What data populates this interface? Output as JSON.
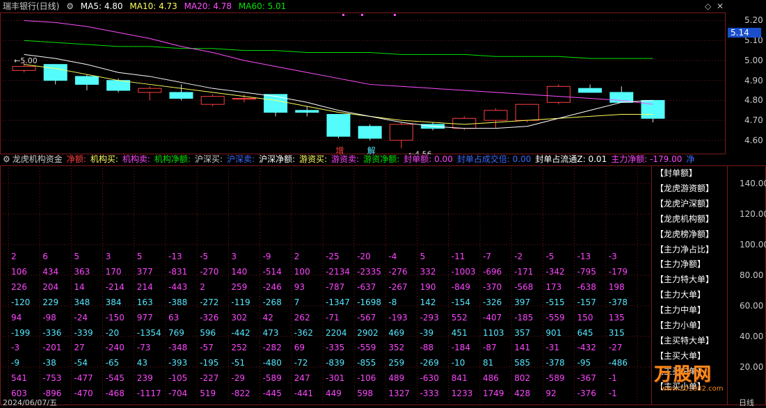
{
  "colors": {
    "up": "#ff4040",
    "down": "#54fcfc",
    "ma5": "#ffffff",
    "ma10": "#ffff5e",
    "ma20": "#ff4fff",
    "ma60": "#00e600",
    "grid": "#7a1a1a",
    "magenta": "#ff45ff",
    "cyan": "#54e8ff",
    "white": "#ffffff"
  },
  "header": {
    "title": "瑞丰银行(日线)",
    "ma5": "MA5: 4.80",
    "ma10": "MA10: 4.73",
    "ma20": "MA20: 4.78",
    "ma60": "MA60: 5.01"
  },
  "price_axis": {
    "labels": [
      "5.20",
      "5.10",
      "5.00",
      "4.90",
      "4.80",
      "4.70",
      "4.60"
    ],
    "current": "5.14"
  },
  "annotations": {
    "high": "5.00",
    "low": "4.56",
    "tag1": "增",
    "tag2": "解"
  },
  "chart_data": {
    "type": "candlestick",
    "ylim": [
      4.53,
      5.24
    ],
    "candles": [
      {
        "o": 4.95,
        "h": 5.0,
        "l": 4.94,
        "c": 4.97
      },
      {
        "o": 4.98,
        "h": 4.98,
        "l": 4.88,
        "c": 4.9
      },
      {
        "o": 4.92,
        "h": 4.93,
        "l": 4.85,
        "c": 4.88
      },
      {
        "o": 4.9,
        "h": 4.91,
        "l": 4.84,
        "c": 4.85
      },
      {
        "o": 4.84,
        "h": 4.87,
        "l": 4.8,
        "c": 4.86
      },
      {
        "o": 4.84,
        "h": 4.88,
        "l": 4.8,
        "c": 4.81
      },
      {
        "o": 4.78,
        "h": 4.83,
        "l": 4.77,
        "c": 4.82
      },
      {
        "o": 4.81,
        "h": 4.83,
        "l": 4.79,
        "c": 4.81
      },
      {
        "o": 4.83,
        "h": 4.83,
        "l": 4.72,
        "c": 4.74
      },
      {
        "o": 4.75,
        "h": 4.77,
        "l": 4.72,
        "c": 4.74
      },
      {
        "o": 4.73,
        "h": 4.73,
        "l": 4.61,
        "c": 4.62
      },
      {
        "o": 4.67,
        "h": 4.68,
        "l": 4.6,
        "c": 4.61
      },
      {
        "o": 4.6,
        "h": 4.69,
        "l": 4.56,
        "c": 4.68
      },
      {
        "o": 4.68,
        "h": 4.69,
        "l": 4.65,
        "c": 4.66
      },
      {
        "o": 4.66,
        "h": 4.72,
        "l": 4.65,
        "c": 4.71
      },
      {
        "o": 4.7,
        "h": 4.76,
        "l": 4.66,
        "c": 4.75
      },
      {
        "o": 4.7,
        "h": 4.78,
        "l": 4.69,
        "c": 4.78
      },
      {
        "o": 4.79,
        "h": 4.88,
        "l": 4.78,
        "c": 4.87
      },
      {
        "o": 4.86,
        "h": 4.88,
        "l": 4.84,
        "c": 4.84
      },
      {
        "o": 4.84,
        "h": 4.87,
        "l": 4.79,
        "c": 4.79
      },
      {
        "o": 4.8,
        "h": 4.8,
        "l": 4.69,
        "c": 4.71
      }
    ],
    "ma5": [
      5.03,
      5.01,
      4.98,
      4.94,
      4.92,
      4.89,
      4.86,
      4.84,
      4.82,
      4.79,
      4.75,
      4.72,
      4.69,
      4.67,
      4.66,
      4.66,
      4.67,
      4.71,
      4.75,
      4.79,
      4.8
    ],
    "ma10": [
      4.98,
      4.96,
      4.93,
      4.9,
      4.88,
      4.86,
      4.84,
      4.82,
      4.8,
      4.77,
      4.74,
      4.72,
      4.7,
      4.69,
      4.68,
      4.69,
      4.7,
      4.71,
      4.72,
      4.73,
      4.73
    ],
    "ma20": [
      5.2,
      5.19,
      5.17,
      5.14,
      5.11,
      5.07,
      5.04,
      5.0,
      4.97,
      4.94,
      4.91,
      4.88,
      4.87,
      4.86,
      4.85,
      4.84,
      4.83,
      4.82,
      4.81,
      4.8,
      4.78
    ],
    "ma60": [
      5.1,
      5.09,
      5.08,
      5.07,
      5.07,
      5.06,
      5.06,
      5.05,
      5.05,
      5.04,
      5.04,
      5.04,
      5.03,
      5.03,
      5.03,
      5.02,
      5.02,
      5.02,
      5.01,
      5.01,
      5.01
    ]
  },
  "lower": {
    "header": [
      {
        "text": "龙虎机构资金",
        "color": "#cccccc"
      },
      {
        "text": "净额:",
        "color": "#ff4040"
      },
      {
        "text": "机构买:",
        "color": "#ffff5e"
      },
      {
        "text": "机构卖:",
        "color": "#ff45ff"
      },
      {
        "text": "机构净额:",
        "color": "#00e600"
      },
      {
        "text": "沪深买:",
        "color": "#cccccc"
      },
      {
        "text": "沪深卖:",
        "color": "#3b6bff"
      },
      {
        "text": "沪深净额:",
        "color": "#ffffff"
      },
      {
        "text": "游资买:",
        "color": "#ffff5e"
      },
      {
        "text": "游资卖:",
        "color": "#ff45ff"
      },
      {
        "text": "游资净额:",
        "color": "#00e600"
      },
      {
        "text": "封单额: 0.00",
        "color": "#ff45ff"
      },
      {
        "text": "封单占成交倍: 0.00",
        "color": "#3b6bff"
      },
      {
        "text": "封单占流通Z: 0.01",
        "color": "#ffffff"
      },
      {
        "text": "主力净额: -179.00",
        "color": "#ff45ff"
      },
      {
        "text": "净",
        "color": "#3b6bff"
      }
    ],
    "axis": [
      "140.00",
      "120.00",
      "100.00",
      "80.00",
      "60.00",
      "40.00",
      "20.00"
    ],
    "buttons": [
      "【封单额】",
      "【龙虎游资额】",
      "【龙虎沪深额】",
      "【龙虎机构额】",
      "【龙虎榜净额】",
      "【主力净占比】",
      "【主力净额】",
      "【主力特大单】",
      "【主力大单】",
      "【主力中单】",
      "【主力小单】",
      "【主买特大单】",
      "【主买大单】",
      "【主买中单】",
      "【主买小单】"
    ],
    "rows": [
      [
        "2",
        "6",
        "5",
        "3",
        "5",
        "-13",
        "-5",
        "3",
        "-9",
        "2",
        "-25",
        "-20",
        "-4",
        "5",
        "-11",
        "-7",
        "-2",
        "-5",
        "-13",
        "-3"
      ],
      [
        "106",
        "434",
        "363",
        "170",
        "377",
        "-831",
        "-270",
        "140",
        "-514",
        "100",
        "-2134",
        "-2335",
        "-276",
        "332",
        "-1003",
        "-696",
        "-171",
        "-342",
        "-795",
        "-179"
      ],
      [
        "226",
        "204",
        "14",
        "-214",
        "214",
        "-443",
        "2",
        "259",
        "-246",
        "93",
        "-787",
        "-637",
        "-267",
        "190",
        "-849",
        "-370",
        "-568",
        "173",
        "-638",
        "198"
      ],
      [
        "-120",
        "229",
        "348",
        "384",
        "163",
        "-388",
        "-272",
        "-119",
        "-268",
        "7",
        "-1347",
        "-1698",
        "-8",
        "142",
        "-154",
        "-326",
        "397",
        "-515",
        "-157",
        "-378"
      ],
      [
        "94",
        "-98",
        "-24",
        "-150",
        "977",
        "63",
        "-326",
        "302",
        "42",
        "262",
        "-71",
        "-567",
        "-193",
        "-293",
        "552",
        "-407",
        "-185",
        "-559",
        "150",
        "135"
      ],
      [
        "-199",
        "-336",
        "-339",
        "-20",
        "-1354",
        "769",
        "596",
        "-442",
        "473",
        "-362",
        "2204",
        "2902",
        "469",
        "-39",
        "451",
        "1103",
        "357",
        "901",
        "645",
        "315"
      ],
      [
        "-3",
        "-201",
        "27",
        "-240",
        "-73",
        "-348",
        "-57",
        "252",
        "-282",
        "69",
        "-335",
        "-559",
        "352",
        "-88",
        "-184",
        "-87",
        "141",
        "-31",
        "-432",
        "-27"
      ],
      [
        "-9",
        "-38",
        "-54",
        "-65",
        "43",
        "-393",
        "-195",
        "-51",
        "-480",
        "-72",
        "-839",
        "-855",
        "259",
        "-269",
        "-10",
        "81",
        "585",
        "-378",
        "-95",
        "-486"
      ],
      [
        "541",
        "-753",
        "-477",
        "-545",
        "239",
        "-105",
        "-227",
        "-29",
        "-589",
        "247",
        "-301",
        "-106",
        "489",
        "-630",
        "841",
        "486",
        "802",
        "-589",
        "-367",
        "-1"
      ],
      [
        "603",
        "-896",
        "-470",
        "-468",
        "-1117",
        "-704",
        "519",
        "-822",
        "-445",
        "-441",
        "449",
        "598",
        "1327",
        "-333",
        "1233",
        "1749",
        "428",
        "92",
        "-376",
        "-1"
      ]
    ],
    "row_colors": [
      "#ff45ff",
      "#ff45ff",
      "#ff45ff",
      "#54e8ff",
      "#ff45ff",
      "#54e8ff",
      "#ff45ff",
      "#54e8ff",
      "#ff45ff",
      "#ff45ff"
    ],
    "date": "2024/06/07/五"
  },
  "bottom_right": "日线",
  "watermark": "万股网",
  "watermark_url": "www.201082.com"
}
